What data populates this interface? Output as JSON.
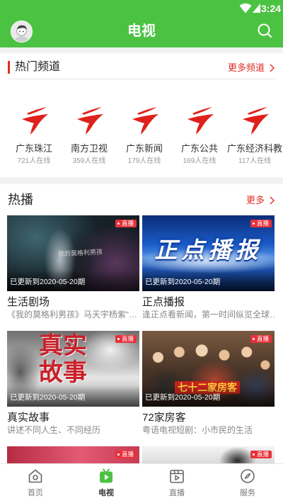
{
  "status_bar": {
    "time": "3:24",
    "icons": [
      "wifi-icon",
      "signal-icon"
    ]
  },
  "header": {
    "title": "电视",
    "left_icon": "avatar",
    "right_icon": "search-icon"
  },
  "hot_channels": {
    "title": "热门频道",
    "more_label": "更多频道",
    "items": [
      {
        "name": "广东珠江",
        "online": "721人在线",
        "logo": "channel-logo-icon"
      },
      {
        "name": "南方卫视",
        "online": "359人在线",
        "logo": "channel-logo-icon"
      },
      {
        "name": "广东新闻",
        "online": "179人在线",
        "logo": "channel-logo-icon"
      },
      {
        "name": "广东公共",
        "online": "169人在线",
        "logo": "channel-logo-icon"
      },
      {
        "name": "广东经济科教",
        "online": "117人在线",
        "logo": "channel-logo-icon"
      }
    ]
  },
  "hot_shows": {
    "title": "热播",
    "more_label": "更多",
    "items": [
      {
        "title": "生活剧场",
        "desc": "《我的莫格利男孩》马天宇杨紫“…",
        "update": "已更新到2020-05-20期",
        "badge": "直播",
        "art": "我的莫格利男孩"
      },
      {
        "title": "正点播报",
        "desc": "逢正点看新闻，第一时间纵览全球…",
        "update": "已更新到2020-05-20期",
        "badge": "直播",
        "art": "正点播报"
      },
      {
        "title": "真实故事",
        "desc": "讲述不同人生、不同经历",
        "update": "已更新到2020-05-20期",
        "badge": "直播",
        "art": "真实故事"
      },
      {
        "title": "72家房客",
        "desc": "粤语电视短剧：小市民的生活",
        "update": "已更新到2020-05-20期",
        "badge": "直播",
        "art": "七十二家房客"
      },
      {
        "badge": "直播"
      },
      {
        "badge": "直播"
      }
    ]
  },
  "bottom_nav": {
    "items": [
      {
        "label": "首页",
        "icon": "home-icon",
        "active": false
      },
      {
        "label": "电视",
        "icon": "tv-icon",
        "active": true
      },
      {
        "label": "直播",
        "icon": "live-video-icon",
        "active": false
      },
      {
        "label": "服务",
        "icon": "compass-icon",
        "active": false
      }
    ]
  },
  "colors": {
    "brand_green": "#4cc243",
    "accent_red": "#e02e24",
    "live_badge": "#e8313a"
  }
}
